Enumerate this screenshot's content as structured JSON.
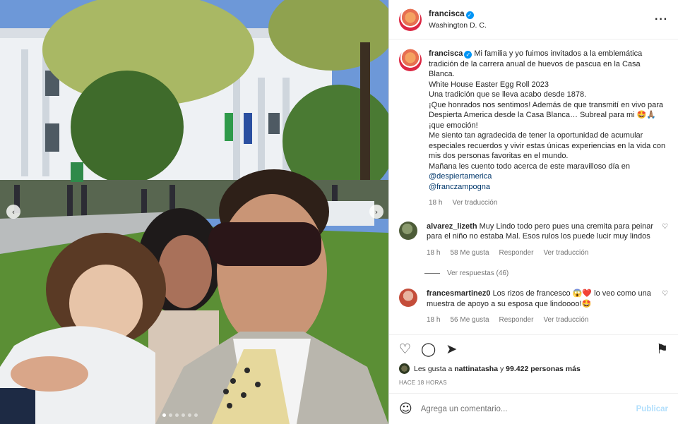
{
  "post": {
    "username": "francisca",
    "location": "Washington D. C.",
    "caption_lines": [
      "Mi familia y yo fuimos invitados a la emblemática tradición de la carrera anual de huevos de pascua en la Casa Blanca.",
      "White House Easter Egg Roll 2023",
      "Una tradición que se lleva acabo desde 1878.",
      "¡Que honrados nos sentimos! Además de que transmití en vivo para Despierta America desde la Casa Blanca… Subreal para mi 🤩🙏🏽 ¡que emoción!",
      "Me siento tan agradecida de tener la oportunidad de acumular especiales recuerdos y vivir estas únicas experiencias en la vida con mis dos personas favoritas en el mundo.",
      "Mañana les cuento todo acerca de este maravilloso día en"
    ],
    "mentions": [
      "@despiertamerica",
      "@franczampogna"
    ],
    "caption_time": "18 h",
    "caption_translate": "Ver traducción"
  },
  "comments": [
    {
      "username": "alvarez_lizeth",
      "text": "Muy Lindo todo pero pues una cremita para peinar para el niño no estaba Mal. Esos rulos los puede lucir muy lindos",
      "time": "18 h",
      "likes": "58 Me gusta",
      "reply": "Responder",
      "translate": "Ver traducción",
      "replies": "Ver respuestas (46)"
    },
    {
      "username": "francesmartinez0",
      "text": "Los rizos de francesco 😱❤️ lo veo como una muestra de apoyo a su esposa que lindoooo!🤩",
      "time": "18 h",
      "likes": "56 Me gusta",
      "reply": "Responder",
      "translate": "Ver traducción"
    }
  ],
  "actions": {
    "liked_by_prefix": "Les gusta a",
    "liked_by_user": "nattinatasha",
    "liked_by_conj": "y",
    "liked_by_count": "99.422 personas más",
    "posted_ago": "HACE 18 HORAS"
  },
  "add_comment": {
    "placeholder": "Agrega un comentario...",
    "publish": "Publicar"
  },
  "icons": {
    "heart": "heart-icon",
    "comment": "comment-icon",
    "share": "share-icon",
    "save": "bookmark-icon",
    "more": "more-options-icon",
    "emoji": "emoji-icon"
  },
  "carousel": {
    "slides": 6,
    "active": 1
  },
  "colors": {
    "verified": "#0095f6",
    "mention": "#00376b",
    "publish": "#b2dffc"
  }
}
